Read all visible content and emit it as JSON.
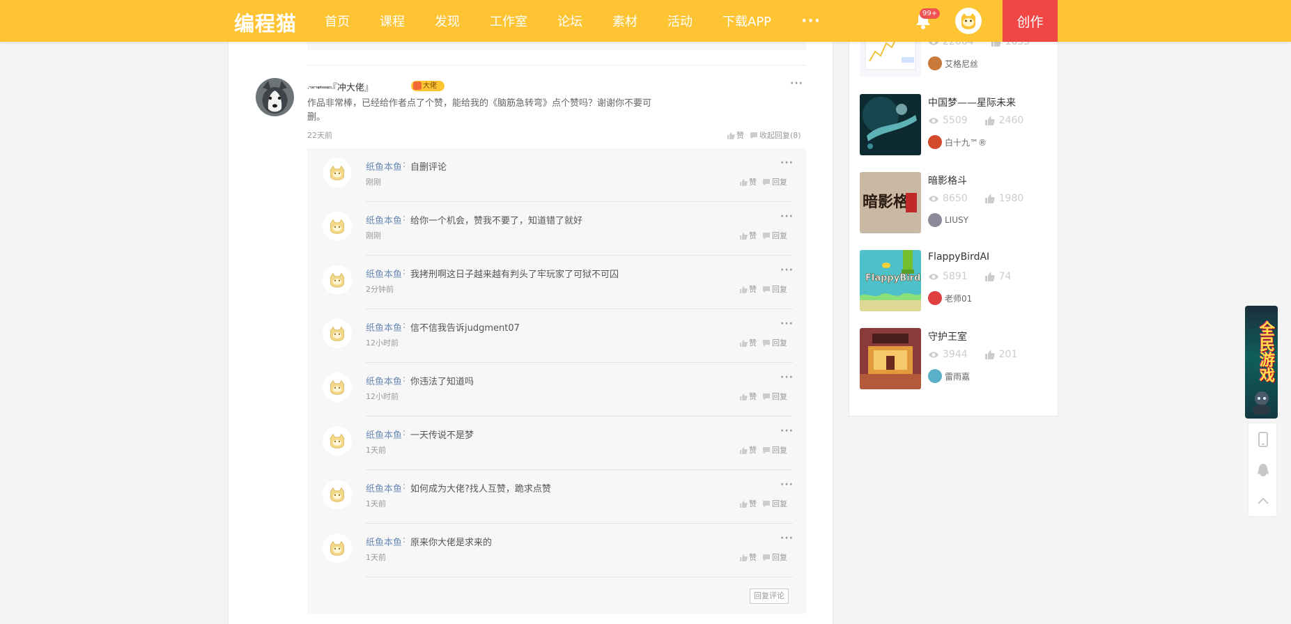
{
  "header": {
    "logo": "编程猫",
    "nav": [
      "首页",
      "课程",
      "发现",
      "工作室",
      "论坛",
      "素材",
      "活动",
      "下载APP"
    ],
    "more": "···",
    "notification_badge": "99+",
    "create_label": "创作",
    "accent_color": "#fec433",
    "create_color": "#f04646"
  },
  "comment": {
    "username_deco": "·ᵔᵒᵉᵔᵉᵎᵉ᠋ᵗᵉᵉᵉᵎᵉᵓ·",
    "username": "『冲大佬』",
    "badge": "大佬",
    "text": "作品非常棒，已经给作者点了个赞，能给我的《脑筋急转弯》点个赞吗？谢谢你不要可删。",
    "time": "22天前",
    "like_label": "赞",
    "collapse_label": "收起回复(8)",
    "more": "···"
  },
  "replies": [
    {
      "name": "纸鱼本鱼",
      "content": "自删评论",
      "time": "刚刚"
    },
    {
      "name": "纸鱼本鱼",
      "content": "给你一个机会，赞我不要了，知道错了就好",
      "time": "刚刚"
    },
    {
      "name": "纸鱼本鱼",
      "content": "我拷刑啊这日子越来越有判头了牢玩家了可狱不可囚",
      "time": "2分钟前"
    },
    {
      "name": "纸鱼本鱼",
      "content": "信不信我告诉judgment07",
      "time": "12小时前"
    },
    {
      "name": "纸鱼本鱼",
      "content": "你违法了知道吗",
      "time": "12小时前"
    },
    {
      "name": "纸鱼本鱼",
      "content": "一天传说不是梦",
      "time": "1天前"
    },
    {
      "name": "纸鱼本鱼",
      "content": "如何成为大佬?找人互赞，跪求点赞",
      "time": "1天前"
    },
    {
      "name": "纸鱼本鱼",
      "content": "原来你大佬是求来的",
      "time": "1天前"
    }
  ],
  "reply_labels": {
    "separator": ":",
    "like": "赞",
    "reply": "回复",
    "more": "···"
  },
  "reply_comment_button": "回复评论",
  "sidebar": {
    "works": [
      {
        "title": "",
        "views": "22064",
        "likes": "1633",
        "author": "艾格尼丝",
        "thumb": "chart",
        "author_color": "#c97a3a"
      },
      {
        "title": "中国梦——星际未来",
        "views": "5509",
        "likes": "2460",
        "author": "白十九™®",
        "thumb": "space",
        "author_color": "#d34a2a"
      },
      {
        "title": "暗影格斗",
        "views": "8650",
        "likes": "1980",
        "author": "LIUSY",
        "thumb": "shadow",
        "author_color": "#8a8a9a"
      },
      {
        "title": "FlappyBirdAI",
        "views": "5891",
        "likes": "74",
        "author": "老师01",
        "thumb": "flappy",
        "author_color": "#e04040"
      },
      {
        "title": "守护王室",
        "views": "3944",
        "likes": "201",
        "author": "雷雨嘉",
        "thumb": "palace",
        "author_color": "#5ab0c8"
      }
    ]
  },
  "promo": {
    "text": "全民游戏"
  }
}
